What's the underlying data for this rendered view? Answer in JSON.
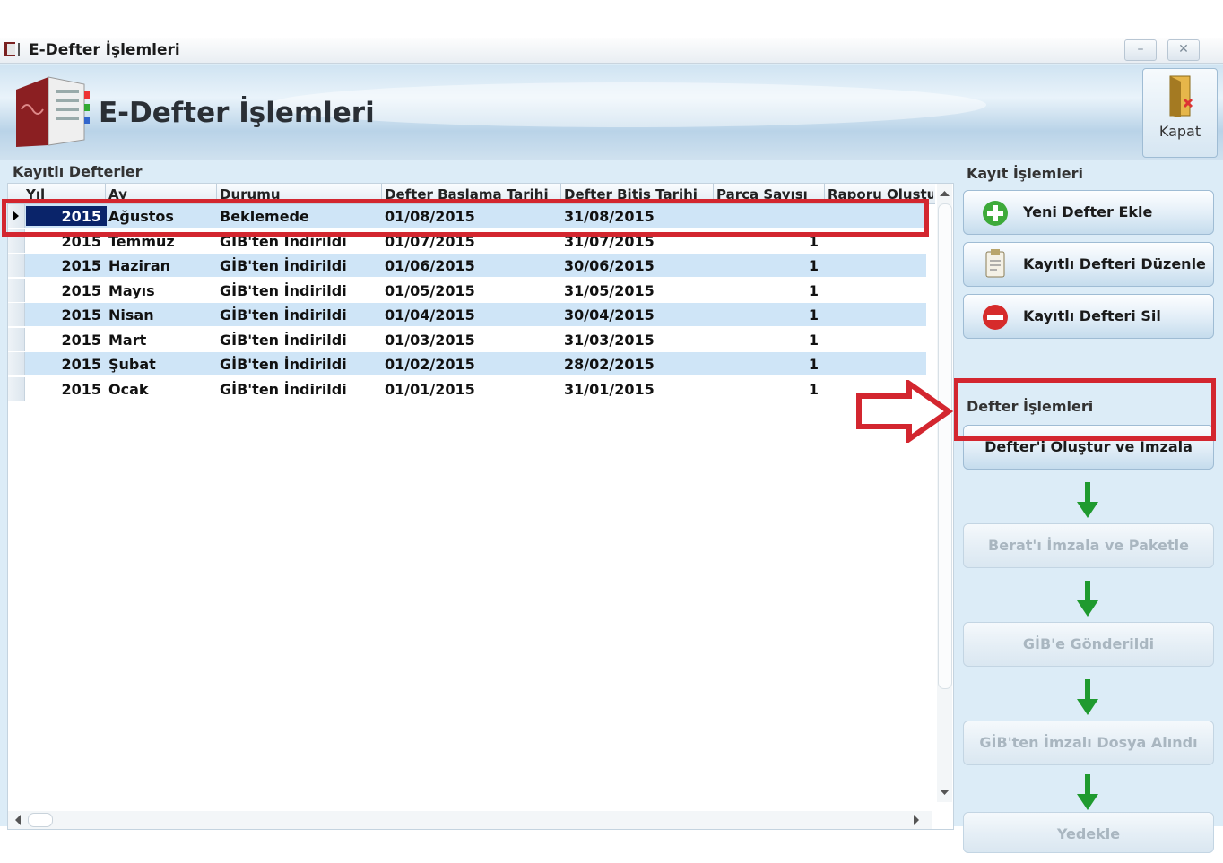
{
  "window": {
    "title": "E-Defter İşlemleri",
    "minimize": "–",
    "close": "✕"
  },
  "header": {
    "title": "E-Defter İşlemleri",
    "close_label": "Kapat"
  },
  "grid": {
    "group_title": "Kayıtlı Defterler",
    "columns": [
      "Yıl",
      "Ay",
      "Durumu",
      "Defter Başlama Tarihi",
      "Defter Bitiş Tarihi",
      "Parça Sayısı",
      "Raporu Oluştu"
    ],
    "rows": [
      {
        "yil": "2015",
        "ay": "Ağustos",
        "durum": "Beklemede",
        "baslama": "01/08/2015",
        "bitis": "31/08/2015",
        "parca": "",
        "selected": true
      },
      {
        "yil": "2015",
        "ay": "Temmuz",
        "durum": "GİB'ten İndirildi",
        "baslama": "01/07/2015",
        "bitis": "31/07/2015",
        "parca": "1"
      },
      {
        "yil": "2015",
        "ay": "Haziran",
        "durum": "GİB'ten İndirildi",
        "baslama": "01/06/2015",
        "bitis": "30/06/2015",
        "parca": "1"
      },
      {
        "yil": "2015",
        "ay": "Mayıs",
        "durum": "GİB'ten İndirildi",
        "baslama": "01/05/2015",
        "bitis": "31/05/2015",
        "parca": "1"
      },
      {
        "yil": "2015",
        "ay": "Nisan",
        "durum": "GİB'ten İndirildi",
        "baslama": "01/04/2015",
        "bitis": "30/04/2015",
        "parca": "1"
      },
      {
        "yil": "2015",
        "ay": "Mart",
        "durum": "GİB'ten İndirildi",
        "baslama": "01/03/2015",
        "bitis": "31/03/2015",
        "parca": "1"
      },
      {
        "yil": "2015",
        "ay": "Şubat",
        "durum": "GİB'ten İndirildi",
        "baslama": "01/02/2015",
        "bitis": "28/02/2015",
        "parca": "1"
      },
      {
        "yil": "2015",
        "ay": "Ocak",
        "durum": "GİB'ten İndirildi",
        "baslama": "01/01/2015",
        "bitis": "31/01/2015",
        "parca": "1"
      }
    ]
  },
  "kayit": {
    "group_title": "Kayıt İşlemleri",
    "add_label": "Yeni Defter Ekle",
    "edit_label": "Kayıtlı Defteri Düzenle",
    "delete_label": "Kayıtlı Defteri Sil"
  },
  "defter": {
    "group_title": "Defter İşlemleri",
    "create_sign_label": "Defter'i Oluştur ve İmzala",
    "berat_label": "Berat'ı İmzala ve Paketle",
    "gib_sent_label": "GİB'e Gönderildi",
    "gib_received_label": "GİB'ten İmzalı Dosya Alındı",
    "backup_label": "Yedekle"
  },
  "colors": {
    "highlight": "#d3262f",
    "selection": "#0a246a",
    "row_alt": "#cfe5f7",
    "arrow_green": "#1f9a2f"
  }
}
